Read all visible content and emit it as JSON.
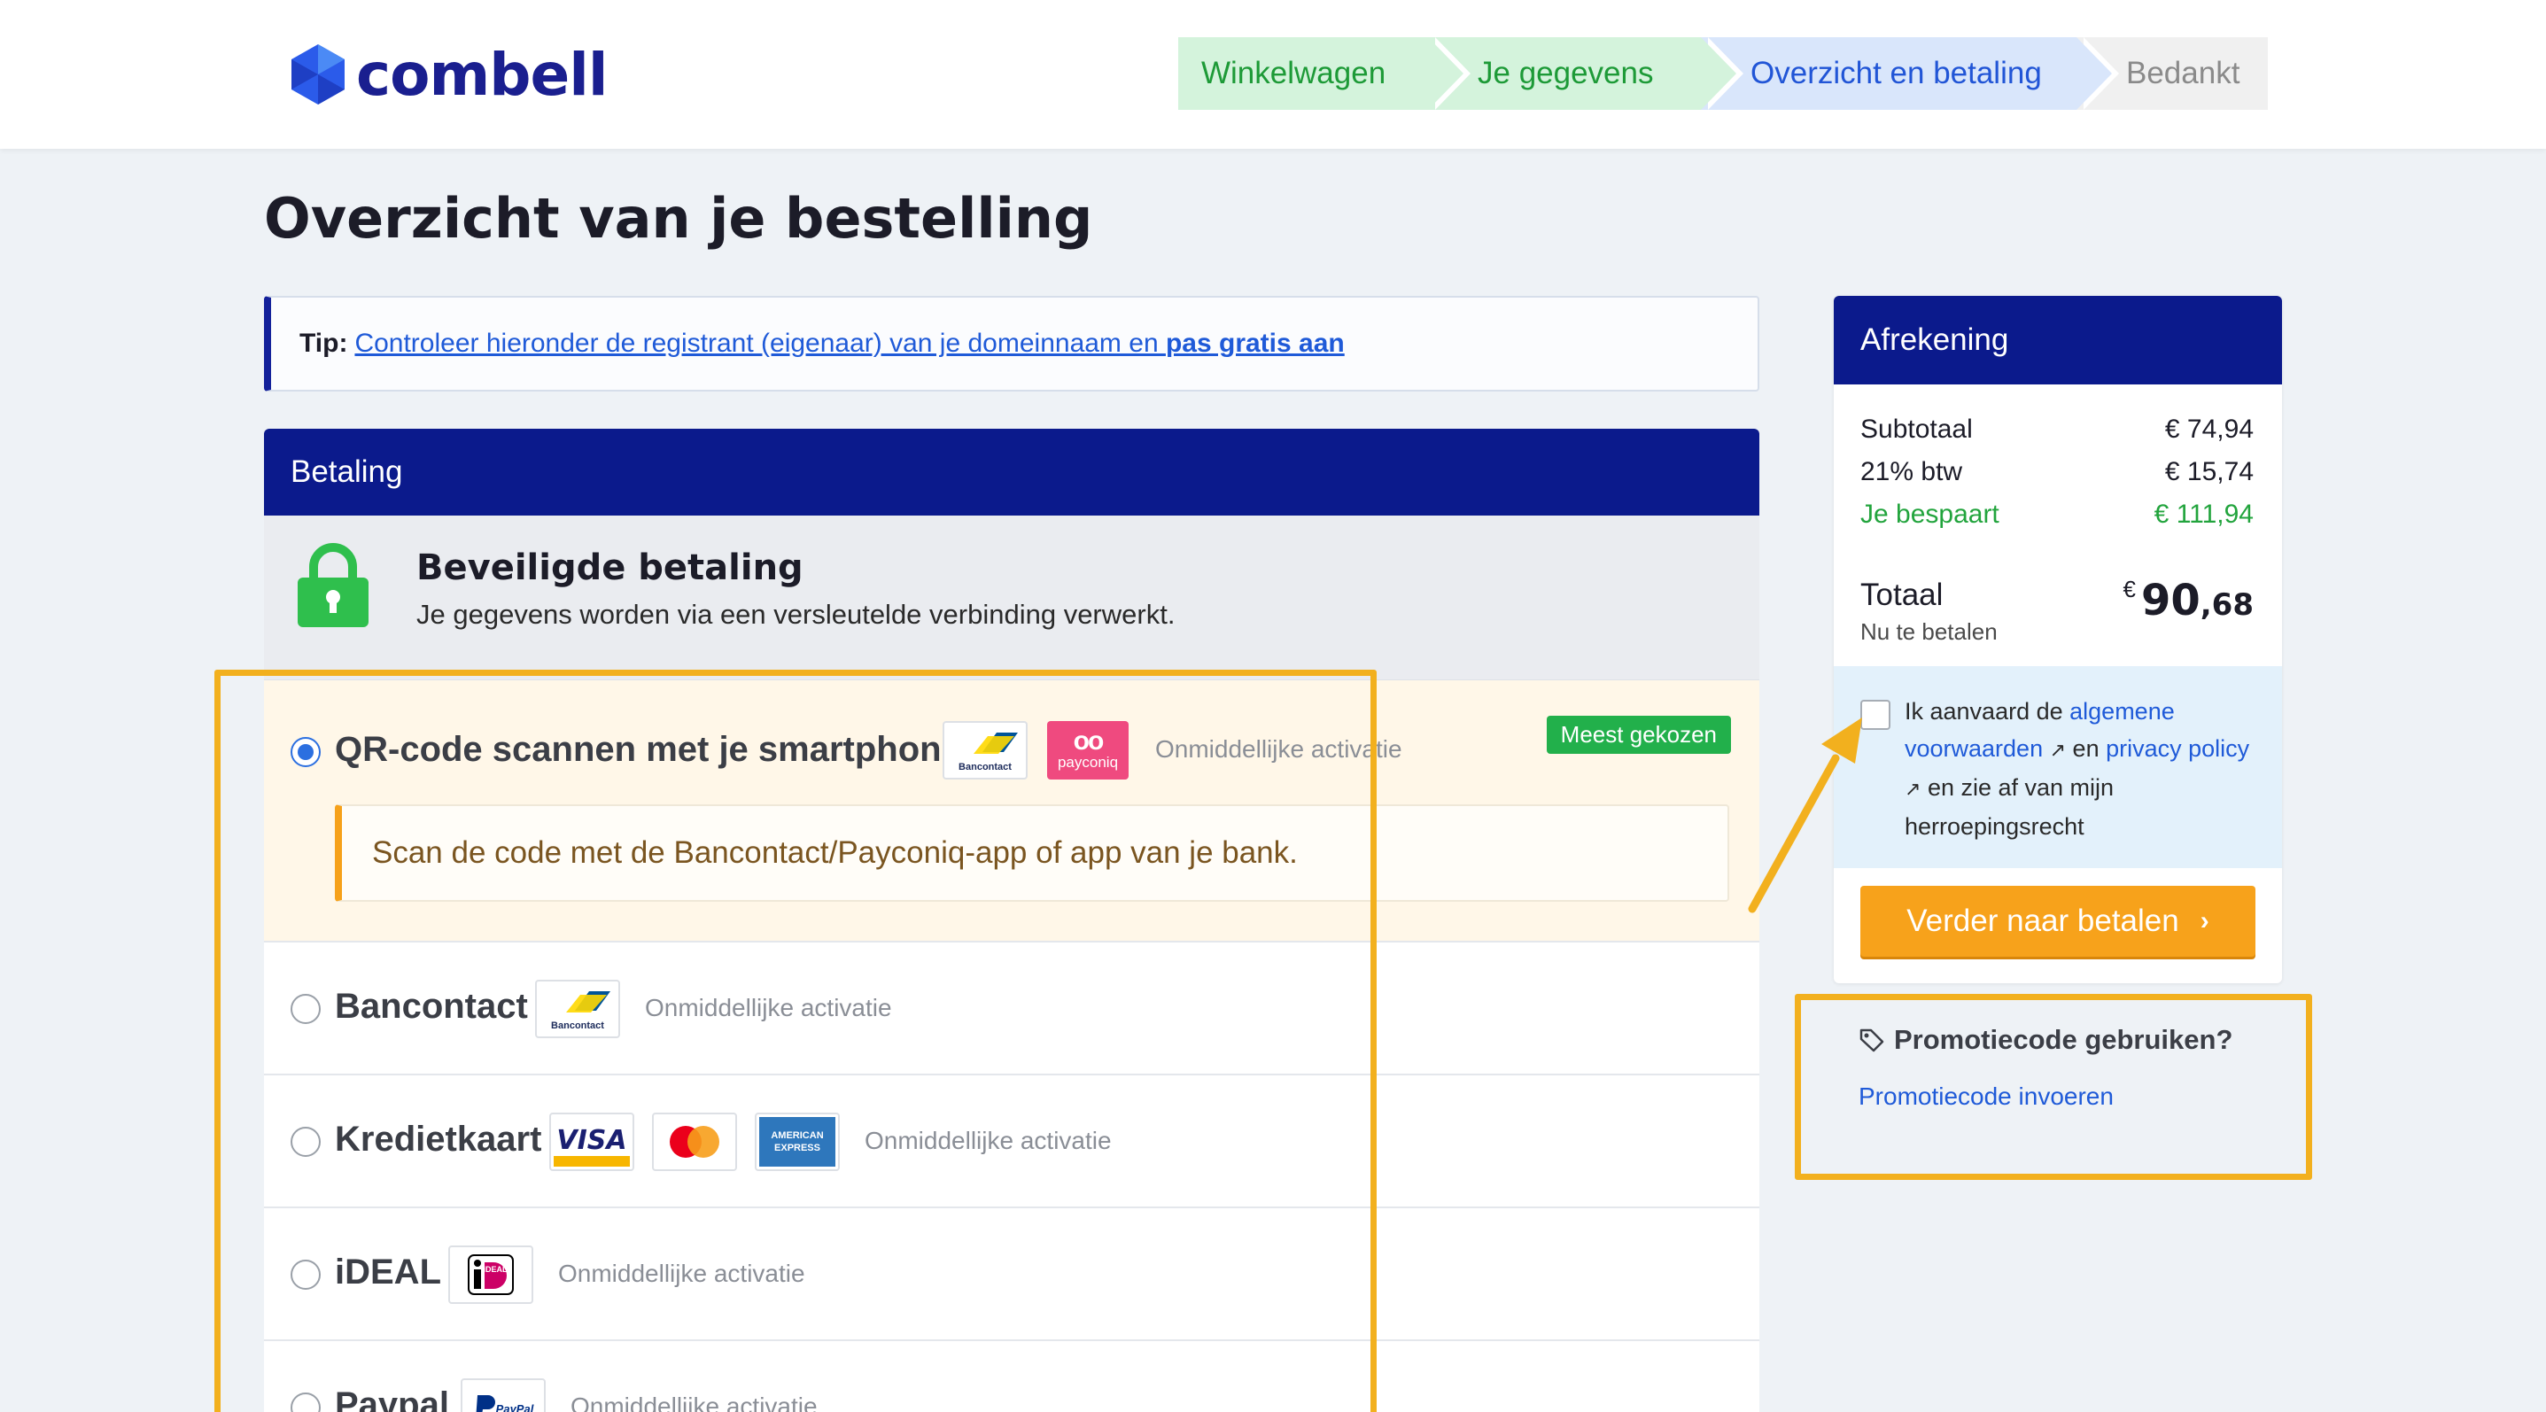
{
  "brand": {
    "name": "combell"
  },
  "steps": [
    {
      "label": "Winkelwagen",
      "state": "done"
    },
    {
      "label": "Je gegevens",
      "state": "done"
    },
    {
      "label": "Overzicht en betaling",
      "state": "active"
    },
    {
      "label": "Bedankt",
      "state": "next"
    }
  ],
  "page_title": "Overzicht van je bestelling",
  "tip": {
    "prefix": "Tip:",
    "link_text": "Controleer hieronder de registrant (eigenaar) van je domeinnaam en ",
    "link_bold": "pas gratis aan"
  },
  "payment": {
    "header": "Betaling",
    "secure_title": "Beveiligde betaling",
    "secure_subtitle": "Je gegevens worden via een versleutelde verbinding verwerkt.",
    "methods": [
      {
        "name": "QR-code scannen met je smartphone",
        "activation": "Onmiddellijke activatie",
        "badge": "Meest gekozen",
        "note": "Scan de code met de Bancontact/Payconiq-app of app van je bank.",
        "selected": true
      },
      {
        "name": "Bancontact",
        "activation": "Onmiddellijke activatie",
        "selected": false
      },
      {
        "name": "Kredietkaart",
        "activation": "Onmiddellijke activatie",
        "selected": false
      },
      {
        "name": "iDEAL",
        "activation": "Onmiddellijke activatie",
        "selected": false
      },
      {
        "name": "Paypal",
        "activation": "Onmiddellijke activatie",
        "selected": false
      }
    ],
    "logos": {
      "bancontact": "Bancontact",
      "payconiq": "payconiq",
      "visa": "VISA",
      "amex": "AMERICAN EXPRESS",
      "ideal": "iDEAL",
      "paypal": "PayPal"
    }
  },
  "checkout": {
    "header": "Afrekening",
    "subtotal_label": "Subtotaal",
    "subtotal_value": "€ 74,94",
    "vat_label": "21% btw",
    "vat_value": "€ 15,74",
    "saved_label": "Je bespaart",
    "saved_value": "€ 111,94",
    "total_label": "Totaal",
    "total_sub": "Nu te betalen",
    "total_currency": "€",
    "total_whole": "90",
    "total_decimal": ",68",
    "terms": {
      "t1": "Ik aanvaard de ",
      "link1": "algemene voorwaarden",
      "t2": " en ",
      "link2": "privacy policy",
      "t3": " en zie af van mijn herroepingsrecht"
    },
    "pay_button": "Verder naar betalen",
    "accepted": false
  },
  "promo": {
    "title": "Promotiecode gebruiken?",
    "link": "Promotiecode invoeren"
  },
  "colors": {
    "brand_navy": "#0b1a8c",
    "accent_orange": "#f7a21b",
    "success_green": "#22a43d",
    "link_blue": "#1f5ad8",
    "highlight_yellow": "#f2b01e"
  }
}
